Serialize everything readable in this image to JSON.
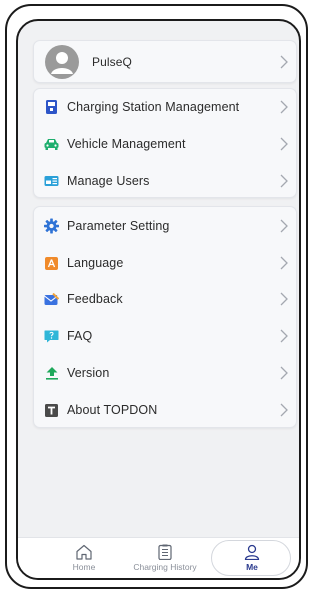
{
  "profile": {
    "name": "PulseQ"
  },
  "group1": [
    {
      "label": "Charging Station Management",
      "icon": "charging-station-icon",
      "color": "#2d55c8"
    },
    {
      "label": "Vehicle Management",
      "icon": "car-icon",
      "color": "#1fae6e"
    },
    {
      "label": "Manage Users",
      "icon": "users-icon",
      "color": "#2aa0d8"
    }
  ],
  "group2": [
    {
      "label": "Parameter Setting",
      "icon": "gear-icon",
      "color": "#2f73d6"
    },
    {
      "label": "Language",
      "icon": "language-icon",
      "color": "#f08a2a"
    },
    {
      "label": "Feedback",
      "icon": "feedback-icon",
      "color": "#3a72e0"
    },
    {
      "label": "FAQ",
      "icon": "faq-icon",
      "color": "#2fb6d8"
    },
    {
      "label": "Version",
      "icon": "version-upload-icon",
      "color": "#1ea85a"
    },
    {
      "label": "About TOPDON",
      "icon": "about-icon",
      "color": "#4a4a4a"
    }
  ],
  "tabbar": {
    "home": "Home",
    "history": "Charging History",
    "me": "Me"
  },
  "colors": {
    "background": "#f0f1f3",
    "active_tab": "#2a3a8e"
  }
}
